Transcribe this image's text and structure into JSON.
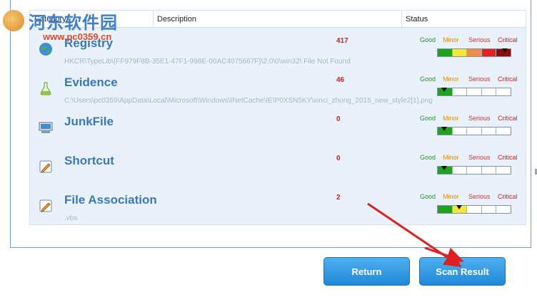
{
  "columns": {
    "category": "Category",
    "description": "Description",
    "status": "Status"
  },
  "severity_labels": {
    "good": "Good",
    "minor": "Minor",
    "serious": "Serious",
    "critical": "Critical"
  },
  "rows": [
    {
      "title": "Registry",
      "detail": "HKCR\\TypeLib\\{FF979F8B-35E1-47F1-998E-00AC4075667F}\\2.0\\0\\win32\\ File Not Found",
      "count": "417",
      "severity_level": 4,
      "icon": "registry-globe-icon"
    },
    {
      "title": "Evidence",
      "detail": "C:\\Users\\pc0359\\AppData\\Local\\Microsoft\\Windows\\INetCache\\IE\\P0XSN5KY\\xinci_zhong_2015_new_style2[1].png",
      "count": "46",
      "severity_level": 0,
      "icon": "evidence-flask-icon"
    },
    {
      "title": "JunkFile",
      "detail": "",
      "count": "0",
      "severity_level": 0,
      "icon": "junkfile-computer-icon"
    },
    {
      "title": "Shortcut",
      "detail": "",
      "count": "0",
      "severity_level": 0,
      "icon": "shortcut-pencil-icon"
    },
    {
      "title": "File Association",
      "detail": ".vbs",
      "count": "2",
      "severity_level": 1,
      "icon": "file-association-pencil-icon"
    }
  ],
  "severity_colors": {
    "good": "#1fa31f",
    "minor": "#f2e73a",
    "serious": "#f28a4a",
    "critical_1": "#e8201c",
    "critical_2": "#8a0c0c"
  },
  "watermark": {
    "text": "河东软件园",
    "url": "www.pc0359.cn"
  },
  "buttons": {
    "return": "Return",
    "scan_result": "Scan Result"
  },
  "accent_color": "#1f88d8"
}
